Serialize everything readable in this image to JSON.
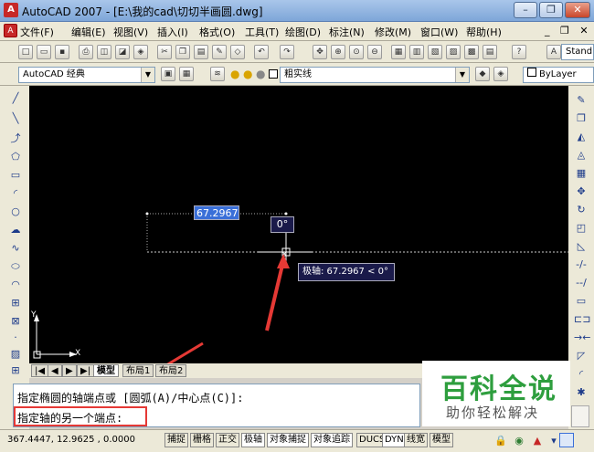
{
  "title_bar": {
    "app_title": "AutoCAD 2007 - [E:\\我的cad\\切切半画圆.dwg]",
    "app_icon_glyph": "A"
  },
  "window_controls": {
    "minimize": "–",
    "restore": "❐",
    "close": "✕"
  },
  "menu": {
    "items": [
      "文件(F)",
      "编辑(E)",
      "视图(V)",
      "插入(I)",
      "格式(O)",
      "工具(T)",
      "绘图(D)",
      "标注(N)",
      "修改(M)",
      "窗口(W)",
      "帮助(H)"
    ],
    "right_glyph": "_ ❐ ✕"
  },
  "toolbar_styles": {
    "workspace_combo": "AutoCAD 经典",
    "layer_combo": "粗实线",
    "bylayer_combo": "ByLayer",
    "text_style_combo": "Stand"
  },
  "canvas": {
    "input_value": "67.2967",
    "angle_tooltip": "0°",
    "polar_tooltip": "极轴: 67.2967 < 0°",
    "ucs_x": "X",
    "ucs_y": "Y"
  },
  "layout_tabs": [
    "模型",
    "布局1",
    "布局2"
  ],
  "tab_nav": [
    "|◀",
    "◀",
    "▶",
    "▶|"
  ],
  "command": {
    "line1": "指定椭圆的轴端点或 [圆弧(A)/中心点(C)]:",
    "line2": "指定轴的另一个端点:"
  },
  "status": {
    "coords": "367.4447, 12.9625 , 0.0000",
    "buttons": [
      "捕捉",
      "栅格",
      "正交",
      "极轴",
      "对象捕捉",
      "对象追踪",
      "DUCS",
      "DYN",
      "线宽",
      "模型"
    ]
  },
  "watermark": {
    "main": "百科全说",
    "sub": "助你轻松解决"
  },
  "colors": {
    "canvas": "#000000",
    "highlight": "#e53935",
    "tooltip_bg": "#1a1a4a",
    "input_bg": "#3a6fd8",
    "watermark_green": "#2e9e3e"
  }
}
